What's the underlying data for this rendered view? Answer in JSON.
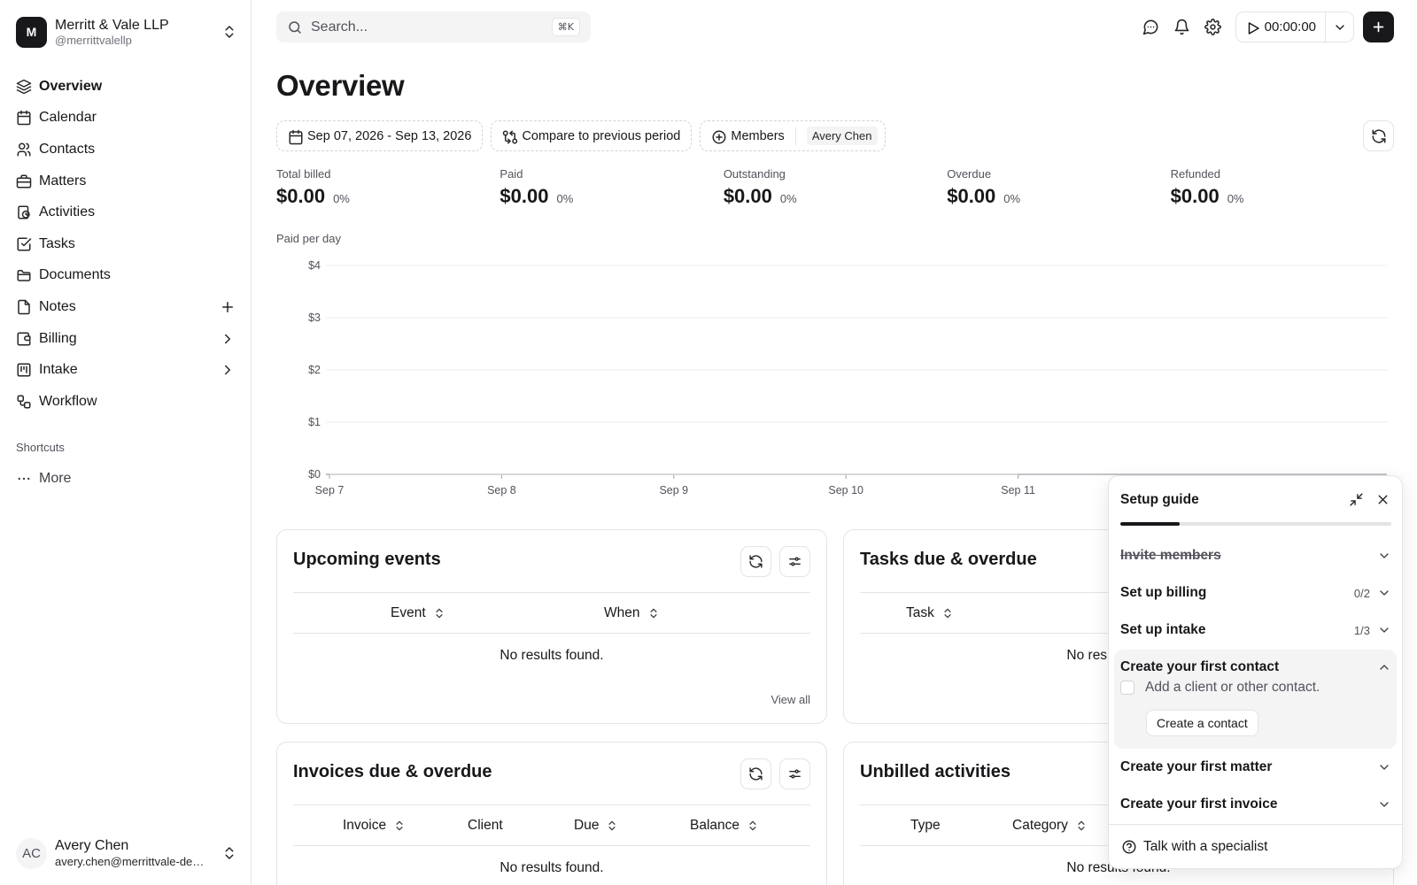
{
  "org": {
    "initial": "M",
    "name": "Merritt & Vale LLP",
    "handle": "@merrittvalellp"
  },
  "sidebar": {
    "items": [
      {
        "label": "Overview",
        "icon": "layers-icon",
        "active": true
      },
      {
        "label": "Calendar",
        "icon": "calendar-icon"
      },
      {
        "label": "Contacts",
        "icon": "users-icon"
      },
      {
        "label": "Matters",
        "icon": "briefcase-icon"
      },
      {
        "label": "Activities",
        "icon": "activity-icon"
      },
      {
        "label": "Tasks",
        "icon": "check-square-icon"
      },
      {
        "label": "Documents",
        "icon": "folder-icon"
      },
      {
        "label": "Notes",
        "icon": "file-icon",
        "trailing": "plus-icon"
      },
      {
        "label": "Billing",
        "icon": "wallet-icon",
        "trailing": "chevron-right-icon"
      },
      {
        "label": "Intake",
        "icon": "kanban-icon",
        "trailing": "chevron-right-icon"
      },
      {
        "label": "Workflow",
        "icon": "workflow-icon"
      }
    ],
    "shortcuts_title": "Shortcuts",
    "more_label": "More"
  },
  "user": {
    "initials": "AC",
    "name": "Avery Chen",
    "email": "avery.chen@merrittvale-demo.com"
  },
  "search": {
    "placeholder": "Search...",
    "shortcut": "⌘K"
  },
  "timer": {
    "value": "00:00:00"
  },
  "page": {
    "title": "Overview"
  },
  "filters": {
    "date_range": "Sep 07, 2026 - Sep 13, 2026",
    "compare": "Compare to previous period",
    "members_label": "Members",
    "member_selected": "Avery Chen"
  },
  "stats": [
    {
      "label": "Total billed",
      "value": "$0.00",
      "delta": "0%"
    },
    {
      "label": "Paid",
      "value": "$0.00",
      "delta": "0%"
    },
    {
      "label": "Outstanding",
      "value": "$0.00",
      "delta": "0%"
    },
    {
      "label": "Overdue",
      "value": "$0.00",
      "delta": "0%"
    },
    {
      "label": "Refunded",
      "value": "$0.00",
      "delta": "0%"
    }
  ],
  "chart_title": "Paid per day",
  "chart_data": {
    "type": "line",
    "title": "Paid per day",
    "categories": [
      "Sep 7",
      "Sep 8",
      "Sep 9",
      "Sep 10",
      "Sep 11"
    ],
    "y_ticks": [
      "$0",
      "$1",
      "$2",
      "$3",
      "$4"
    ],
    "ylim": [
      0,
      4
    ],
    "series": [
      {
        "values": [
          0,
          0,
          0,
          0,
          0
        ]
      }
    ],
    "grid": true,
    "colors": {
      "grid": "#ececef",
      "axis": "#a1a1aa",
      "line": "#d4d4d8"
    }
  },
  "cards": {
    "upcoming": {
      "title": "Upcoming events",
      "columns": [
        "Event",
        "When"
      ],
      "empty": "No results found.",
      "view_all": "View all"
    },
    "tasks": {
      "title": "Tasks due & overdue",
      "columns": [
        "Task"
      ],
      "empty": "No results found."
    },
    "invoices": {
      "title": "Invoices due & overdue",
      "columns": [
        "Invoice",
        "Client",
        "Due",
        "Balance"
      ],
      "empty": "No results found."
    },
    "unbilled": {
      "title": "Unbilled activities",
      "columns": [
        "Type",
        "Category"
      ],
      "empty": "No results found."
    }
  },
  "guide": {
    "title": "Setup guide",
    "progress": 0.22,
    "steps": [
      {
        "label": "Invite members",
        "done": true
      },
      {
        "label": "Set up billing",
        "count": "0/2"
      },
      {
        "label": "Set up intake",
        "count": "1/3"
      },
      {
        "label": "Create your first contact",
        "expanded": true,
        "subtask": "Add a client or other contact.",
        "action": "Create a contact"
      },
      {
        "label": "Create your first matter"
      },
      {
        "label": "Create your first invoice"
      }
    ],
    "footer": "Talk with a specialist"
  }
}
